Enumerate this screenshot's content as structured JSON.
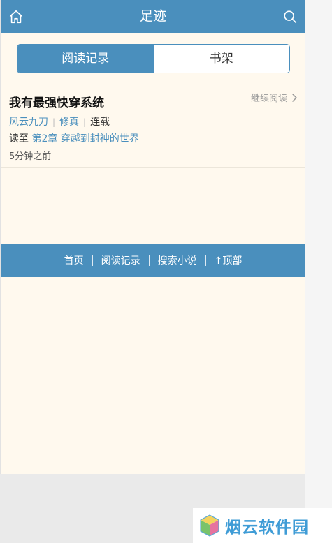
{
  "header": {
    "title": "足迹",
    "home_icon": "home-icon",
    "search_icon": "search-icon"
  },
  "tabs": [
    {
      "label": "阅读记录",
      "active": true
    },
    {
      "label": "书架",
      "active": false
    }
  ],
  "record": {
    "book_title": "我有最强快穿系统",
    "continue_label": "继续阅读",
    "author": "风云九刀",
    "category": "修真",
    "status": "连载",
    "read_prefix": "读至",
    "chapter": "第2章 穿越到封神的世界",
    "time": "5分钟之前"
  },
  "footer_nav": {
    "items": [
      "首页",
      "阅读记录",
      "搜索小说",
      "↑顶部"
    ]
  },
  "watermark": {
    "text": "烟云软件园"
  },
  "colors": {
    "primary": "#4a8fbd",
    "background": "#fff9ee",
    "link": "#4a8fbd"
  }
}
